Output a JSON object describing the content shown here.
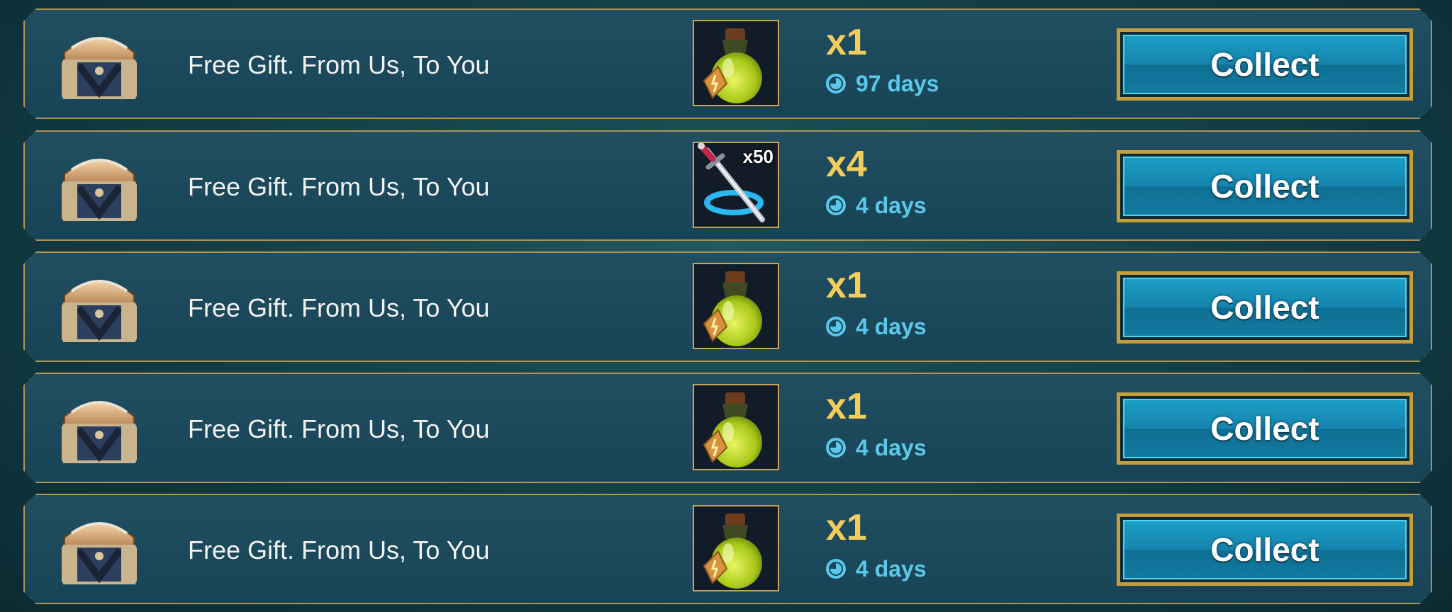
{
  "colors": {
    "panel": "#18475a",
    "border_gold": "#b29253",
    "quantity_gold": "#f2cd5c",
    "timer_blue": "#5bc8ea",
    "button_blue": "#1684ad"
  },
  "gifts": [
    {
      "title": "Free Gift. From Us, To You",
      "icon": "chest-icon",
      "item_icon": "energy-potion-icon",
      "item_badge": "",
      "quantity": "x1",
      "time_left": "97 days",
      "button_label": "Collect"
    },
    {
      "title": "Free Gift. From Us, To You",
      "icon": "chest-icon",
      "item_icon": "multi-battle-sword-icon",
      "item_badge": "x50",
      "quantity": "x4",
      "time_left": "4 days",
      "button_label": "Collect"
    },
    {
      "title": "Free Gift. From Us, To You",
      "icon": "chest-icon",
      "item_icon": "energy-potion-icon",
      "item_badge": "",
      "quantity": "x1",
      "time_left": "4 days",
      "button_label": "Collect"
    },
    {
      "title": "Free Gift. From Us, To You",
      "icon": "chest-icon",
      "item_icon": "energy-potion-icon",
      "item_badge": "",
      "quantity": "x1",
      "time_left": "4 days",
      "button_label": "Collect"
    },
    {
      "title": "Free Gift. From Us, To You",
      "icon": "chest-icon",
      "item_icon": "energy-potion-icon",
      "item_badge": "",
      "quantity": "x1",
      "time_left": "4 days",
      "button_label": "Collect"
    }
  ]
}
